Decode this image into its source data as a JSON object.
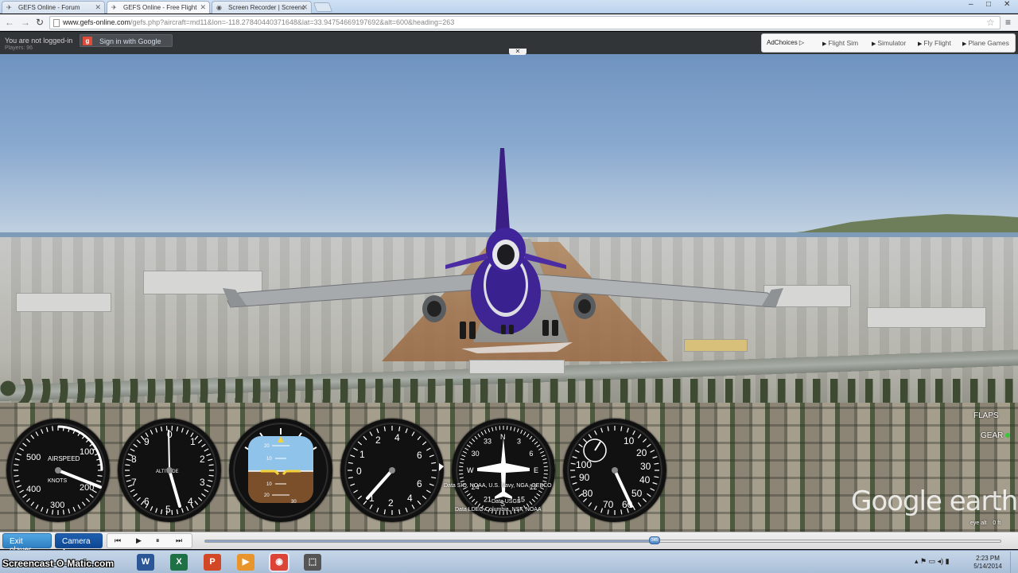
{
  "browser": {
    "tabs": [
      {
        "label": "GEFS Online - Forum",
        "active": false
      },
      {
        "label": "GEFS Online - Free Flight",
        "active": true
      },
      {
        "label": "Screen Recorder | Screenc",
        "active": false
      }
    ],
    "url_host": "www.gefs-online.com",
    "url_path": "/gefs.php?aircraft=md11&lon=-118.27840440371648&lat=33.94754669197692&alt=600&heading=263",
    "window_controls": {
      "minimize": "–",
      "maximize": "□",
      "close": "✕"
    }
  },
  "gefs_header": {
    "login_message": "You are not logged-in",
    "players": "Players: 96",
    "sign_in_label": "Sign in with Google",
    "adchoices_label": "AdChoices",
    "ad_links": [
      "Flight Sim",
      "Simulator",
      "Fly Flight",
      "Plane Games"
    ],
    "dismiss_label": "✕"
  },
  "instruments": {
    "airspeed": {
      "title": "AIRSPEED",
      "unit": "KNOTS",
      "ticks": [
        "100",
        "200",
        "300",
        "400",
        "500"
      ],
      "needle_knots": 210
    },
    "altimeter": {
      "ticks": [
        "0",
        "1",
        "2",
        "3",
        "4",
        "5",
        "6",
        "7",
        "8",
        "9"
      ],
      "label": "ALTITUDE"
    },
    "attitude": {
      "pitch_marks": [
        "20",
        "10",
        "10",
        "20",
        "30"
      ]
    },
    "vsi": {
      "ticks": [
        "0",
        "1",
        "2",
        "4",
        "6",
        "4",
        "2",
        "1",
        "6"
      ]
    },
    "heading": {
      "ticks": [
        "N",
        "3",
        "6",
        "E",
        "12",
        "15",
        "S",
        "21",
        "24",
        "W",
        "30",
        "33"
      ]
    },
    "tachometer": {
      "ticks": [
        "10",
        "20",
        "30",
        "40",
        "50",
        "60",
        "70",
        "80",
        "90",
        "100"
      ]
    }
  },
  "overlay": {
    "flaps_label": "FLAPS",
    "gear_label": "GEAR",
    "watermark": "Google earth",
    "credit_1": "Data SIO, NOAA, U.S. Navy, NGA, GEBCO",
    "credit_2": "Data USGS",
    "credit_3": "Data LDEO-Columbia, NSF, NOAA",
    "eye_alt_label": "eye alt",
    "eye_alt_value": "0 ft"
  },
  "controls": {
    "exit_label": "Exit player",
    "camera_label": "Camera ▴",
    "playback": [
      "⏮",
      "▶",
      "⏸",
      "⏭"
    ],
    "timeline_value": "345",
    "timeline_progress": 0.565
  },
  "taskbar": {
    "screencast_label": "Screencast-O-Matic.com",
    "apps": [
      {
        "name": "word-icon",
        "glyph": "W",
        "color": "#2b5797"
      },
      {
        "name": "excel-icon",
        "glyph": "X",
        "color": "#1e7145"
      },
      {
        "name": "powerpoint-icon",
        "glyph": "P",
        "color": "#d24726"
      },
      {
        "name": "media-player-icon",
        "glyph": "▶",
        "color": "#e8962b"
      },
      {
        "name": "chrome-icon",
        "glyph": "◉",
        "color": "#db4437"
      },
      {
        "name": "snipping-tool-icon",
        "glyph": "⬚",
        "color": "#555555"
      }
    ],
    "time": "2:23 PM",
    "date": "5/14/2014"
  }
}
